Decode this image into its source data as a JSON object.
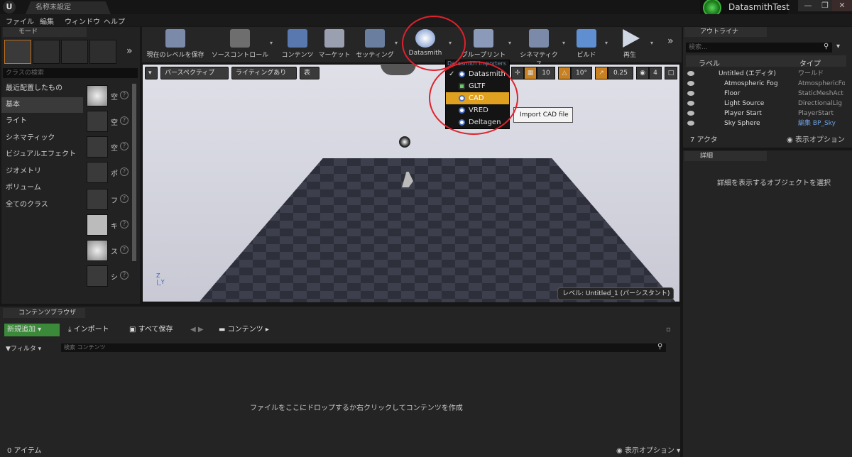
{
  "window": {
    "doc_tab": "名称未設定",
    "project": "DatasmithTest",
    "btn_min": "—",
    "btn_max": "❐",
    "btn_close": "✕"
  },
  "menu": [
    "ファイル",
    "編集",
    "ウィンドウ",
    "ヘルプ"
  ],
  "modes": {
    "tab": "モード",
    "search_placeholder": "クラスの検索",
    "categories": [
      "最近配置したもの",
      "基本",
      "ライト",
      "シネマティック",
      "ビジュアルエフェクト",
      "ジオメトリ",
      "ボリューム",
      "全てのクラス"
    ],
    "selected_category": "基本",
    "items": [
      "空",
      "空",
      "空",
      "ポ",
      "フ",
      "キ",
      "ス",
      "シ"
    ]
  },
  "toolbar": {
    "buttons": [
      "現在のレベルを保存",
      "ソースコントロール",
      "コンテンツ",
      "マーケット",
      "セッティング",
      "Datasmith",
      "ブループリント",
      "シネマティクス",
      "ビルド",
      "再生"
    ],
    "more": "»"
  },
  "viewport": {
    "perspective": "パースペクティブ",
    "lighting": "ライティングあり",
    "show": "表示",
    "grid_snap": "10",
    "rot_snap": "10°",
    "scale_snap": "0.25",
    "cam_speed": "4",
    "level_label": "レベル: Untitled_1 (パーシスタント)"
  },
  "datasmith_menu": {
    "header": "Datasmith Importers",
    "items": [
      "Datasmith",
      "GLTF",
      "CAD",
      "VRED",
      "Deltagen"
    ],
    "checked": "Datasmith",
    "highlighted": "CAD"
  },
  "tooltip": "Import CAD file",
  "outliner": {
    "tab": "アウトライナ",
    "search_placeholder": "検索...",
    "col_label": "ラベル",
    "col_type": "タイプ",
    "rows": [
      {
        "name": "Untitled (エディタ)",
        "type": "ワールド"
      },
      {
        "name": "Atmospheric Fog",
        "type": "AtmosphericFo"
      },
      {
        "name": "Floor",
        "type": "StaticMeshAct"
      },
      {
        "name": "Light Source",
        "type": "DirectionalLig"
      },
      {
        "name": "Player Start",
        "type": "PlayerStart"
      },
      {
        "name": "Sky Sphere",
        "type": "編集 BP_Sky"
      }
    ],
    "count": "7 アクタ",
    "view_options": "表示オプション"
  },
  "details": {
    "tab": "詳細",
    "empty_msg": "詳細を表示するオブジェクトを選択"
  },
  "content_browser": {
    "tab": "コンテンツブラウザ",
    "add_new": "新規追加",
    "import": "インポート",
    "save_all": "すべて保存",
    "path": "コンテンツ",
    "filter": "フィルタ",
    "search_placeholder": "検索 コンテンツ",
    "empty_msg": "ファイルをここにドロップするか右クリックしてコンテンツを作成",
    "item_count": "0 アイテム",
    "view_options": "表示オプション"
  }
}
